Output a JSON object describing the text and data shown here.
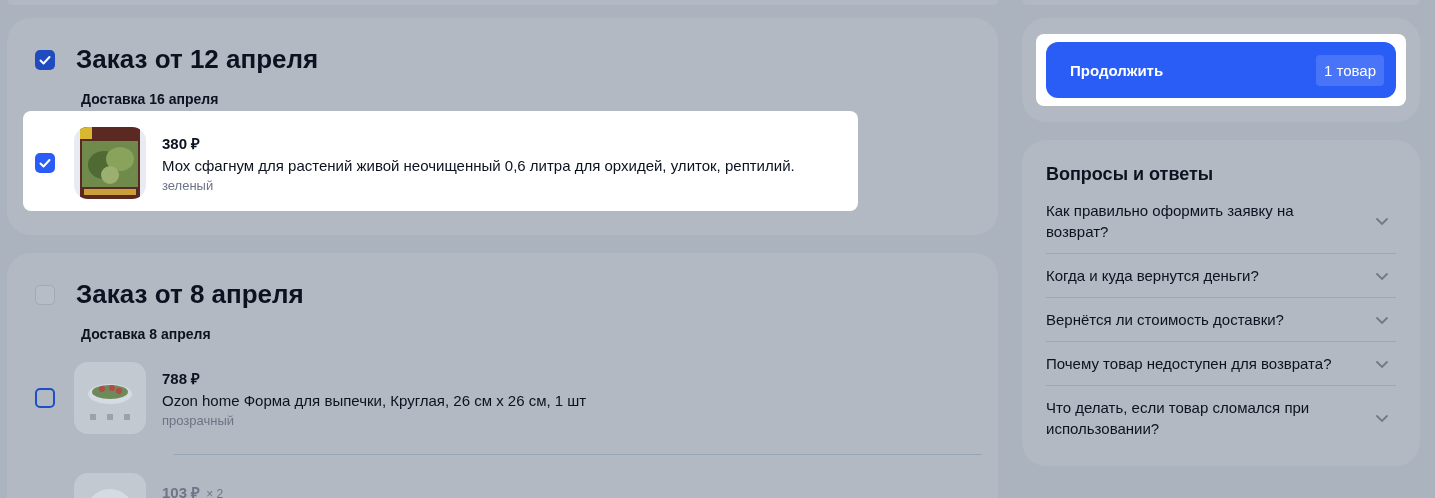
{
  "orders": [
    {
      "title": "Заказ от 12 апреля",
      "selected": true,
      "delivery": "Доставка 16 апреля",
      "items": [
        {
          "price": "380 ₽",
          "name": "Мох сфагнум для растений живой неочищенный 0,6 литра для орхидей, улиток, рептилий.",
          "variant": "зеленый",
          "selected": true,
          "highlighted": true,
          "disabled": false
        }
      ]
    },
    {
      "title": "Заказ от 8 апреля",
      "selected": false,
      "delivery": "Доставка 8 апреля",
      "items": [
        {
          "price": "788 ₽",
          "name": "Ozon home Форма для выпечки, Круглая, 26 см х 26 см, 1 шт",
          "variant": "прозрачный",
          "selected": false,
          "highlighted": false,
          "disabled": false
        },
        {
          "price": "103 ₽",
          "quantity": "× 2",
          "highlighted": false,
          "disabled": true
        }
      ]
    }
  ],
  "checkout": {
    "button": "Продолжить",
    "count": "1 товар",
    "highlighted": true
  },
  "faq": {
    "title": "Вопросы и ответы",
    "items": [
      {
        "question": "Как правильно оформить заявку на возврат?",
        "expanded": false
      },
      {
        "question": "Когда и куда вернутся деньги?",
        "expanded": false
      },
      {
        "question": "Вернётся ли стоимость доставки?",
        "expanded": false
      },
      {
        "question": "Почему товар недоступен для возврата?",
        "expanded": false
      },
      {
        "question": "Что делать, если товар сломался при использовании?",
        "expanded": false
      }
    ]
  }
}
